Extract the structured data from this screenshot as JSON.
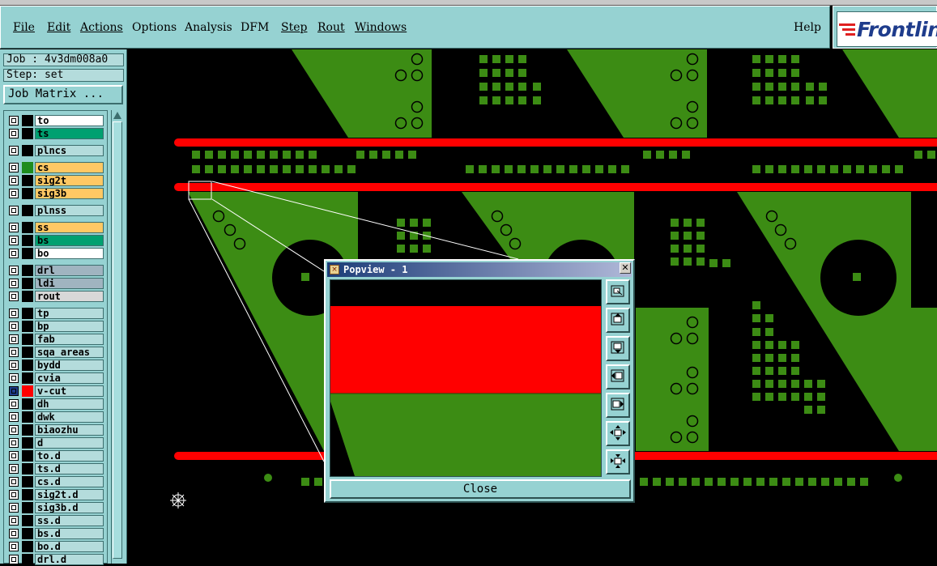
{
  "menu": {
    "items": [
      "File",
      "Edit",
      "Actions",
      "Options",
      "Analysis",
      "DFM",
      "Step",
      "Rout",
      "Windows"
    ],
    "help": "Help"
  },
  "logo": {
    "text": "Frontline"
  },
  "job": {
    "label": "Job : 4v3dm008a0",
    "step": "Step: set",
    "matrix_button": "Job Matrix ..."
  },
  "layers": [
    {
      "name": "to",
      "color": "#ffffff",
      "swatch": "#000000"
    },
    {
      "name": "ts",
      "color": "#00a070",
      "swatch": "#000000"
    },
    {
      "name": "plncs",
      "color": "#b4dcdc",
      "swatch": "#000000"
    },
    {
      "name": "cs",
      "color": "#ffc864",
      "swatch": "#1e8c1e"
    },
    {
      "name": "sig2t",
      "color": "#ffc864",
      "swatch": "#000000"
    },
    {
      "name": "sig3b",
      "color": "#ffc864",
      "swatch": "#000000"
    },
    {
      "name": "plnss",
      "color": "#b4dcdc",
      "swatch": "#000000"
    },
    {
      "name": "ss",
      "color": "#ffc864",
      "swatch": "#000000"
    },
    {
      "name": "bs",
      "color": "#00a070",
      "swatch": "#000000"
    },
    {
      "name": "bo",
      "color": "#ffffff",
      "swatch": "#000000"
    },
    {
      "name": "drl",
      "color": "#a0b4c0",
      "swatch": "#000000"
    },
    {
      "name": "ldi",
      "color": "#a0b4c0",
      "swatch": "#000000"
    },
    {
      "name": "rout",
      "color": "#d8d8d8",
      "swatch": "#000000"
    },
    {
      "name": "tp",
      "color": "#b4dcdc",
      "swatch": "#000000"
    },
    {
      "name": "bp",
      "color": "#b4dcdc",
      "swatch": "#000000"
    },
    {
      "name": "fab",
      "color": "#b4dcdc",
      "swatch": "#000000"
    },
    {
      "name": "sqa_areas",
      "color": "#b4dcdc",
      "swatch": "#000000"
    },
    {
      "name": "bydd",
      "color": "#b4dcdc",
      "swatch": "#000000"
    },
    {
      "name": "cvia",
      "color": "#b4dcdc",
      "swatch": "#000000"
    },
    {
      "name": "v-cut",
      "color": "#b4dcdc",
      "swatch": "#ff0000",
      "active": true
    },
    {
      "name": "dh",
      "color": "#b4dcdc",
      "swatch": "#000000"
    },
    {
      "name": "dwk",
      "color": "#b4dcdc",
      "swatch": "#000000"
    },
    {
      "name": "biaozhu",
      "color": "#b4dcdc",
      "swatch": "#000000"
    },
    {
      "name": "d",
      "color": "#b4dcdc",
      "swatch": "#000000"
    },
    {
      "name": "to.d",
      "color": "#b4dcdc",
      "swatch": "#000000"
    },
    {
      "name": "ts.d",
      "color": "#b4dcdc",
      "swatch": "#000000"
    },
    {
      "name": "cs.d",
      "color": "#b4dcdc",
      "swatch": "#000000"
    },
    {
      "name": "sig2t.d",
      "color": "#b4dcdc",
      "swatch": "#000000"
    },
    {
      "name": "sig3b.d",
      "color": "#b4dcdc",
      "swatch": "#000000"
    },
    {
      "name": "ss.d",
      "color": "#b4dcdc",
      "swatch": "#000000"
    },
    {
      "name": "bs.d",
      "color": "#b4dcdc",
      "swatch": "#000000"
    },
    {
      "name": "bo.d",
      "color": "#b4dcdc",
      "swatch": "#000000"
    },
    {
      "name": "drl.d",
      "color": "#b4dcdc",
      "swatch": "#000000"
    }
  ],
  "popview": {
    "title": "Popview - 1",
    "close_label": "Close"
  },
  "colors": {
    "panel": "#96d2d2",
    "copper": "#3c8c14",
    "vcut": "#ff0000"
  }
}
